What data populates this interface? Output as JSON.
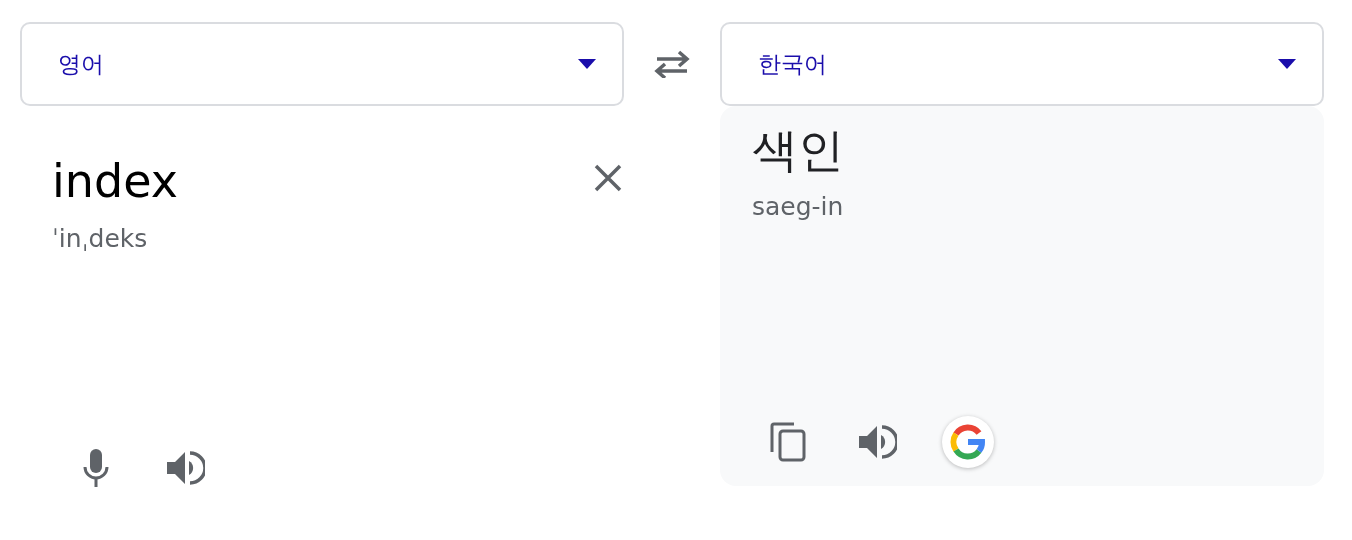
{
  "source_language": {
    "label": "영어"
  },
  "target_language": {
    "label": "한국어"
  },
  "source": {
    "text": "index",
    "pronunciation": "ˈinˌdeks"
  },
  "target": {
    "text": "색인",
    "romanization": "saeg-in"
  }
}
